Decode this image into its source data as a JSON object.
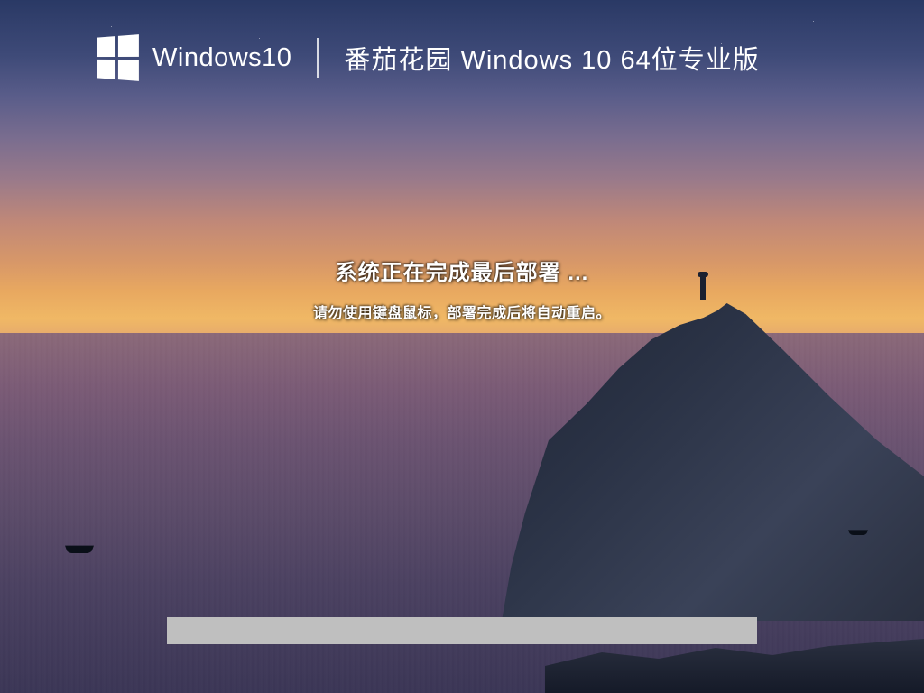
{
  "header": {
    "brand": "Windows10",
    "edition": "番茄花园 Windows 10 64位专业版"
  },
  "messages": {
    "status": "系统正在完成最后部署 ...",
    "warning": "请勿使用键盘鼠标，部署完成后将自动重启。"
  },
  "progress": {
    "percent": 0
  }
}
